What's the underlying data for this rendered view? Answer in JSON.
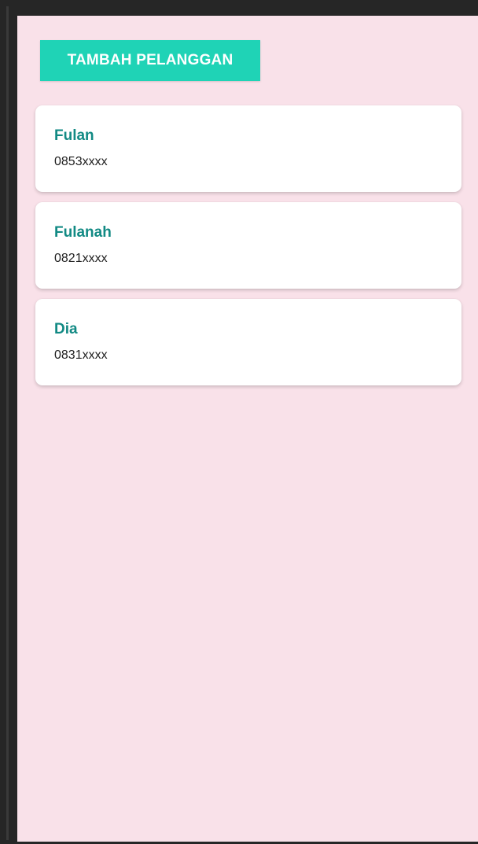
{
  "toolbar": {
    "add_customer_label": "TAMBAH PELANGGAN"
  },
  "customers": [
    {
      "name": "Fulan",
      "phone": "0853xxxx"
    },
    {
      "name": "Fulanah",
      "phone": "0821xxxx"
    },
    {
      "name": "Dia",
      "phone": "0831xxxx"
    }
  ],
  "colors": {
    "screen_background": "#f9e1e9",
    "button_background": "#1fd3b6",
    "name_text": "#128a84",
    "card_background": "#ffffff"
  }
}
